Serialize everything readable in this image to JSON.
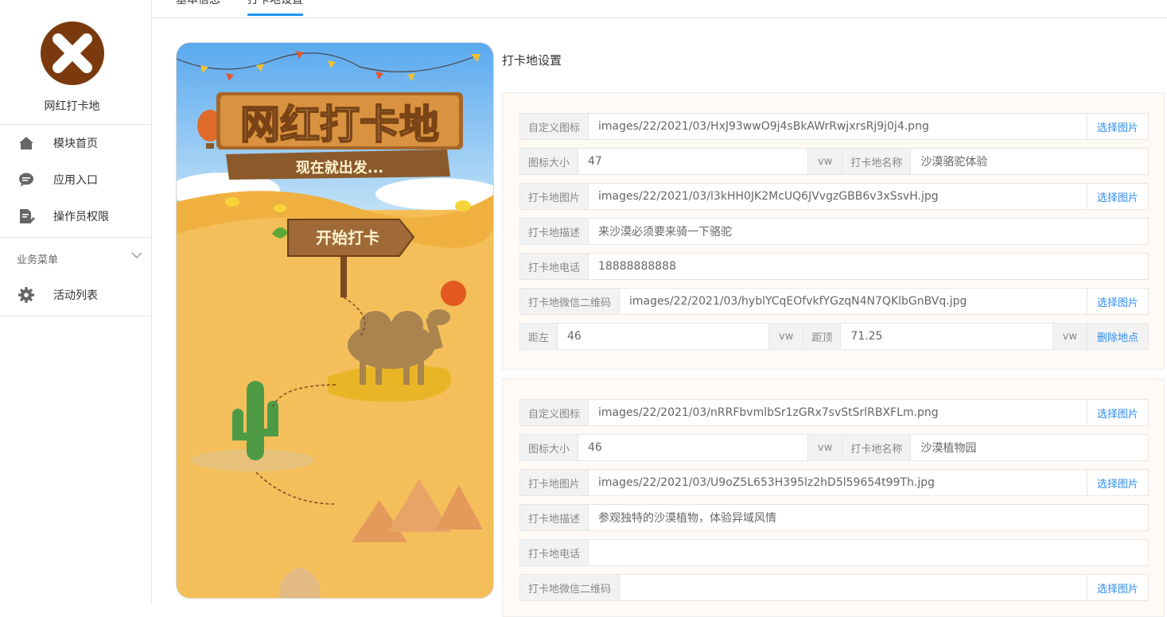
{
  "sidebar": {
    "logo_text": "网红打卡地",
    "items": [
      {
        "label": "模块首页",
        "icon": "home-icon"
      },
      {
        "label": "应用入口",
        "icon": "chat-icon"
      },
      {
        "label": "操作员权限",
        "icon": "document-edit-icon"
      }
    ],
    "section_label": "业务菜单",
    "section_items": [
      {
        "label": "活动列表",
        "icon": "gear-icon"
      }
    ]
  },
  "tabs": [
    {
      "label": "基本信息",
      "active": false
    },
    {
      "label": "打卡地设置",
      "active": true
    }
  ],
  "poster": {
    "title": "网红打卡地",
    "subtitle": "现在就出发...",
    "sign": "开始打卡"
  },
  "panel_title": "打卡地设置",
  "labels": {
    "custom_icon": "自定义图标",
    "icon_size": "图标大小",
    "unit_vw": "vw",
    "spot_name": "打卡地名称",
    "spot_image": "打卡地图片",
    "spot_desc": "打卡地描述",
    "spot_phone": "打卡地电话",
    "spot_qr": "打卡地微信二维码",
    "left": "距左",
    "top": "距顶",
    "choose_image": "选择图片",
    "delete_spot": "删除地点"
  },
  "spots": [
    {
      "custom_icon": "images/22/2021/03/HxJ93wwO9j4sBkAWrRwjxrsRj9j0j4.png",
      "icon_size": "47",
      "name": "沙漠骆驼体验",
      "image": "images/22/2021/03/l3kHH0JK2McUQ6JVvgzGBB6v3xSsvH.jpg",
      "desc": "来沙漠必须要来骑一下骆驼",
      "phone": "18888888888",
      "qr": "images/22/2021/03/hyblYCqEOfvkfYGzqN4N7QKlbGnBVq.jpg",
      "left": "46",
      "top": "71.25"
    },
    {
      "custom_icon": "images/22/2021/03/nRRFbvmlbSr1zGRx7svStSrlRBXFLm.png",
      "icon_size": "46",
      "name": "沙漠植物园",
      "image": "images/22/2021/03/U9oZ5L653H395lz2hD5l59654t99Th.jpg",
      "desc": "参观独特的沙漠植物，体验异域风情",
      "phone": "",
      "qr": ""
    }
  ],
  "colors": {
    "accent": "#2d8cf0",
    "tab_active": "#2196f3",
    "logo_bg": "#7b3a0e",
    "card_bg": "#fffaf5"
  }
}
